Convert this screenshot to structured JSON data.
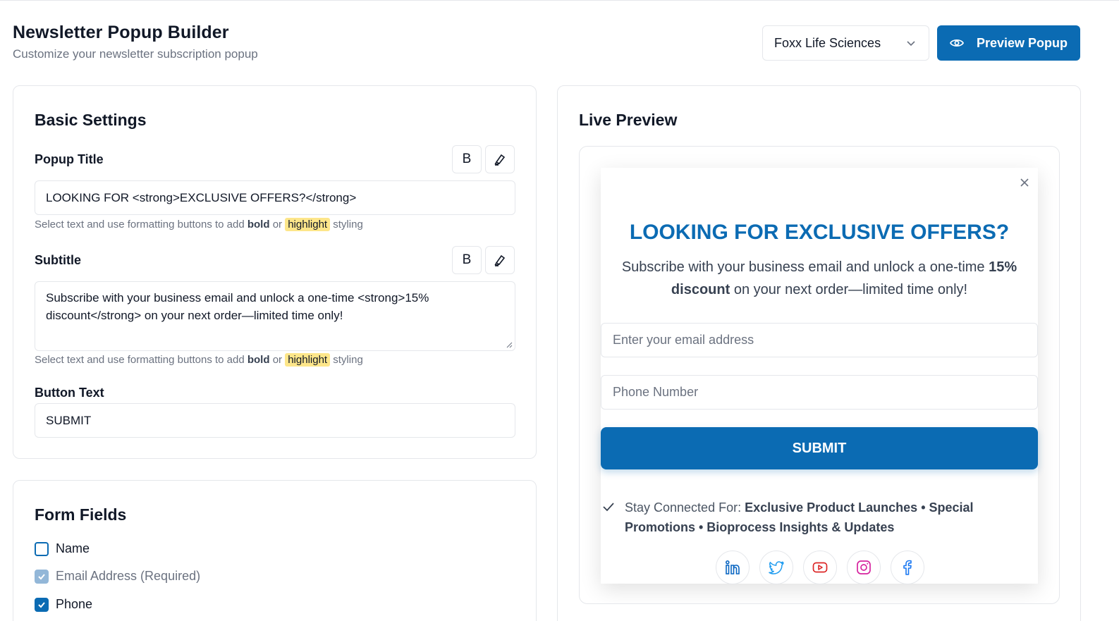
{
  "header": {
    "title": "Newsletter Popup Builder",
    "subtitle": "Customize your newsletter subscription popup",
    "brand_select": "Foxx Life Sciences",
    "preview_button": "Preview Popup"
  },
  "basic_settings": {
    "title": "Basic Settings",
    "popup_title_label": "Popup Title",
    "popup_title_value": "LOOKING FOR <strong>EXCLUSIVE OFFERS?</strong>",
    "hint_prefix": "Select text and use formatting buttons to add",
    "hint_bold": "bold",
    "hint_or": "or",
    "hint_highlight": "highlight",
    "hint_suffix": "styling",
    "bold_btn": "B",
    "subtitle_label": "Subtitle",
    "subtitle_value": "Subscribe with your business email and unlock a one-time <strong>15% discount</strong> on your next order—limited time only!",
    "button_text_label": "Button Text",
    "button_text_value": "SUBMIT"
  },
  "form_fields": {
    "title": "Form Fields",
    "fields": [
      {
        "label": "Name",
        "checked": false
      },
      {
        "label": "Email Address (Required)",
        "checked": true
      },
      {
        "label": "Phone",
        "checked": true
      }
    ]
  },
  "preview": {
    "title": "Live Preview",
    "popup_title_plain": "LOOKING FOR",
    "popup_title_bold": "EXCLUSIVE OFFERS?",
    "sub_before": "Subscribe with your business email and unlock a one-time",
    "sub_bold": "15% discount",
    "sub_after": "on your next order—limited time only!",
    "email_placeholder": "Enter your email address",
    "phone_placeholder": "Phone Number",
    "submit": "SUBMIT",
    "stay_prefix": "Stay Connected For:",
    "stay_items": "Exclusive Product Launches • Special Promotions • Bioprocess Insights & Updates",
    "socials": [
      "linkedin-icon",
      "twitter-icon",
      "youtube-icon",
      "instagram-icon",
      "facebook-icon"
    ]
  },
  "colors": {
    "accent": "#0b6bb3",
    "highlight": "#fde68a",
    "linkedin": "#0a66c2",
    "twitter": "#1d9bf0",
    "youtube": "#dc2626",
    "instagram": "#d6249f",
    "facebook": "#1877f2"
  }
}
